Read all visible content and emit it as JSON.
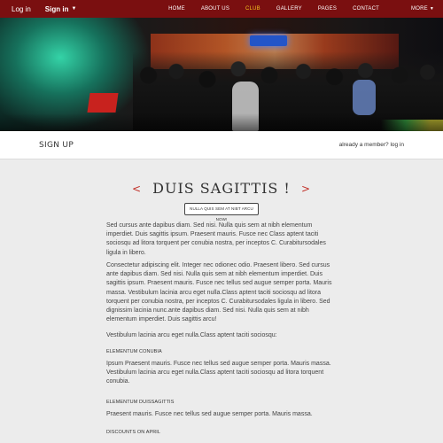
{
  "topbar": {
    "login": "Log in",
    "signin": "Sign in",
    "nav": [
      {
        "label": "HOME",
        "active": false
      },
      {
        "label": "ABOUT US",
        "active": false
      },
      {
        "label": "CLUB",
        "active": true
      },
      {
        "label": "GALLERY",
        "active": false
      },
      {
        "label": "PAGES",
        "active": false
      },
      {
        "label": "CONTACT",
        "active": false
      },
      {
        "label": "MORE",
        "active": false
      }
    ]
  },
  "signup": {
    "title": "SIGN UP",
    "member_link": "already a member? log in"
  },
  "main": {
    "heading_left": "<",
    "heading": "DUIS SAGITTIS !",
    "heading_right": ">",
    "cta": "NULLA QUIS SEM AT NIBT ARCU NOW!",
    "p1": "Sed cursus ante dapibus diam. Sed nisi. Nulla quis sem at nibh elementum imperdiet. Duis sagittis ipsum. Praesent mauris. Fusce nec Class aptent taciti sociosqu ad litora torquent per conubia nostra, per inceptos C. Curabitursodales ligula in libero.",
    "p2": "Consectetur adipiscing elit. Integer nec odionec odio. Praesent libero. Sed cursus ante dapibus diam. Sed nisi. Nulla quis sem at nibh elementum imperdiet. Duis sagittis ipsum. Praesent mauris. Fusce nec tellus sed augue semper porta. Mauris massa. Vestibulum lacinia arcu eget nulla.Class aptent taciti sociosqu ad litora torquent per conubia nostra, per inceptos C. Curabitursodales ligula in libero. Sed dignissim lacinia nunc.ante dapibus diam. Sed nisi. Nulla quis sem at nibh elementum imperdiet. Duis sagittis arcu!",
    "p3": "Vestibulum lacinia arcu eget nulla.Class aptent taciti sociosqu:",
    "sub1": "ELEMENTUM CONUBIA",
    "p4": "Ipsum Praesent mauris. Fusce nec tellus sed augue semper porta. Mauris massa. Vestibulum lacinia arcu eget nulla.Class aptent taciti sociosqu ad litora torquent conubia.",
    "sub2": "ELEMENTUM DUISSAGITTIS",
    "p5": "Praesent mauris. Fusce nec tellus sed augue semper porta. Mauris massa.",
    "sub3": "DISCOUNTS ON APRIL"
  },
  "colors": {
    "topbar": "#7a0f10",
    "nav_active": "#f4c21f",
    "accent_red": "#c02b23"
  },
  "icons": {
    "signin_caret": "chevron-down-icon",
    "more_caret": "chevron-down-icon"
  }
}
